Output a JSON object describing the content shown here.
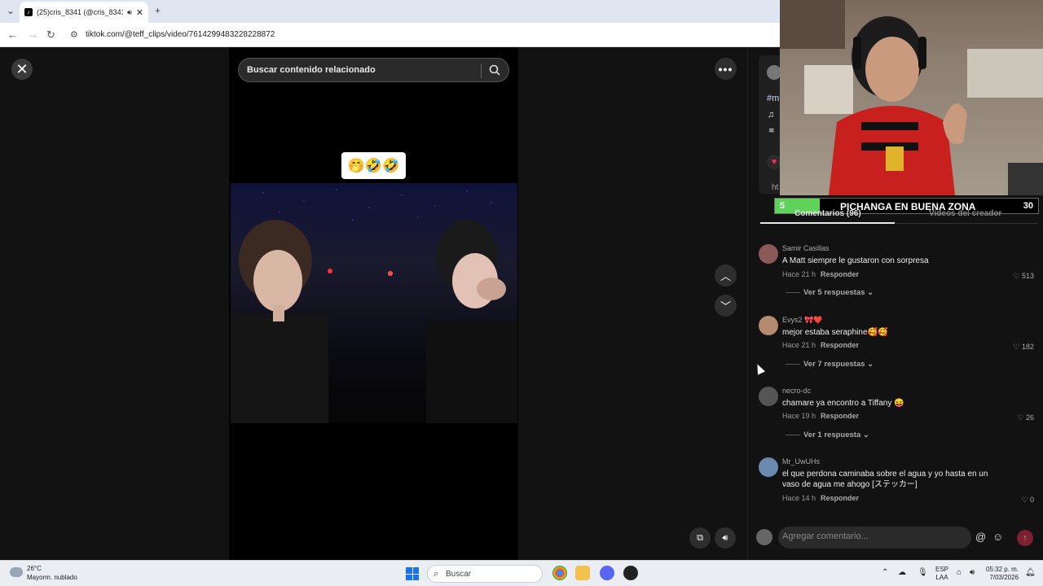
{
  "browser": {
    "tab_title": "(25)cris_8341 (@cris_8341) |",
    "url": "tiktok.com/@teff_clips/video/7614299483228228872"
  },
  "video_view": {
    "search_placeholder": "Buscar contenido relacionado",
    "overlay_emojis": "🤭🤣🤣"
  },
  "side_info": {
    "hashtag_fragment": "#m",
    "link_fragment": "ht"
  },
  "stream_overlay": {
    "left_score": "5",
    "title": "PICHANGA EN BUENA ZONA",
    "right_score": "30",
    "progress_fraction": 0.17
  },
  "comments_panel": {
    "tab_comments": "Comentarios (96)",
    "tab_creator": "Videos del creador",
    "reply_label": "Responder",
    "comments": [
      {
        "user": "Samir Casillas",
        "text": "A Matt siempre le gustaron con sorpresa",
        "time": "Hace 21 h",
        "likes": "513",
        "more": "Ver 5 respuestas"
      },
      {
        "user": "Evys2 🎀❤️",
        "text": "mejor estaba seraphine🥰🥰",
        "time": "Hace 21 h",
        "likes": "182",
        "more": "Ver 7 respuestas"
      },
      {
        "user": "necro-dc",
        "text": "chamare ya encontro a Tiffany 😝",
        "time": "Hace 19 h",
        "likes": "26",
        "more": "Ver 1 respuesta"
      },
      {
        "user": "Mr_UwUHs",
        "text": "el que perdona caminaba sobre el agua y yo hasta en un vaso de agua me ahogo [ステッカー]",
        "time": "Hace 14 h",
        "likes": "0",
        "more": ""
      }
    ],
    "input_placeholder": "Agregar comentario..."
  },
  "taskbar": {
    "temp": "26°C",
    "weather": "Mayorm. nublado",
    "search_label": "Buscar",
    "lang_line1": "ESP",
    "lang_line2": "LAA",
    "time": "05:32 p. m.",
    "date": "7/03/2026"
  }
}
